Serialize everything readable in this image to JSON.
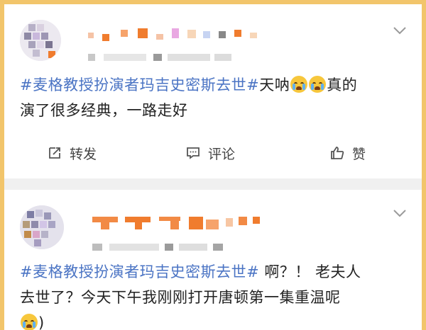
{
  "posts": [
    {
      "hashtag": "#麦格教授扮演者玛吉史密斯去世#",
      "text_before_emoji": "天呐",
      "emojis": [
        "crying-emoji",
        "crying-emoji"
      ],
      "text_after_emoji": "真的",
      "line2": "演了很多经典，一路走好",
      "actions": {
        "repost": "转发",
        "comment": "评论",
        "like": "赞"
      }
    },
    {
      "hashtag": "#麦格教授扮演者玛吉史密斯去世#",
      "line1_rest": " 啊？！ 老夫人",
      "line2": "去世了？今天下午我刚刚打开唐顿第一集重温呢",
      "emoji": "crying-emoji",
      "line3_tail": ")"
    }
  ],
  "colors": {
    "hashtag": "#4b74c4",
    "text": "#222222",
    "background": "#f2c56b"
  }
}
